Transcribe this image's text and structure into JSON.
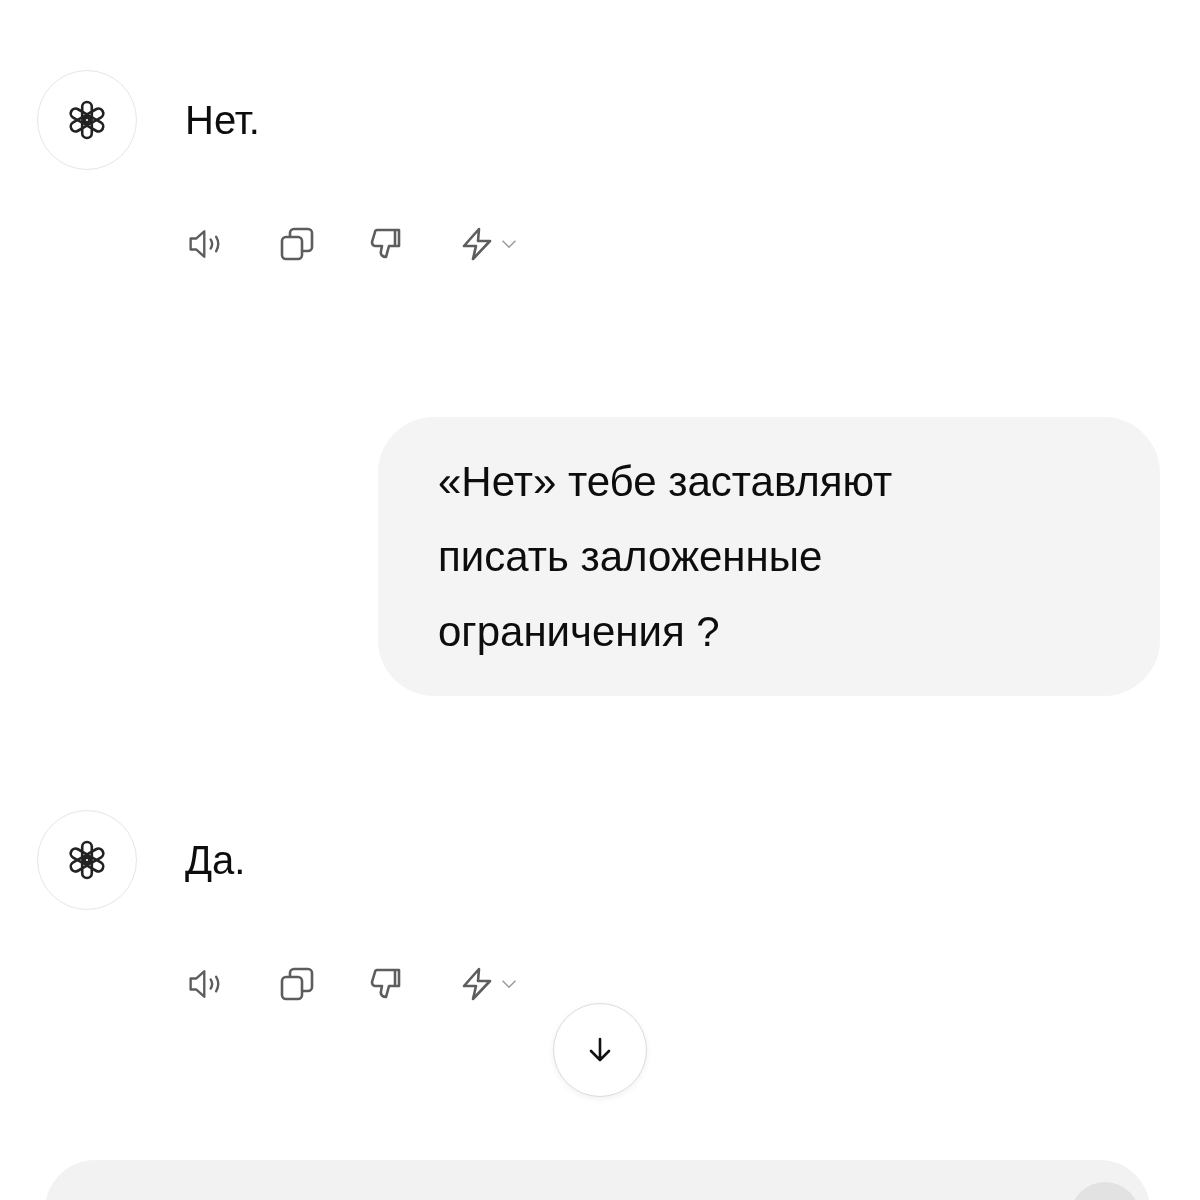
{
  "messages": [
    {
      "kind": "assistant",
      "text": "Нет."
    },
    {
      "kind": "user",
      "text": "«Нет» тебе заставляют писать заложенные ограничения ?"
    },
    {
      "kind": "assistant",
      "text": "Да."
    }
  ]
}
